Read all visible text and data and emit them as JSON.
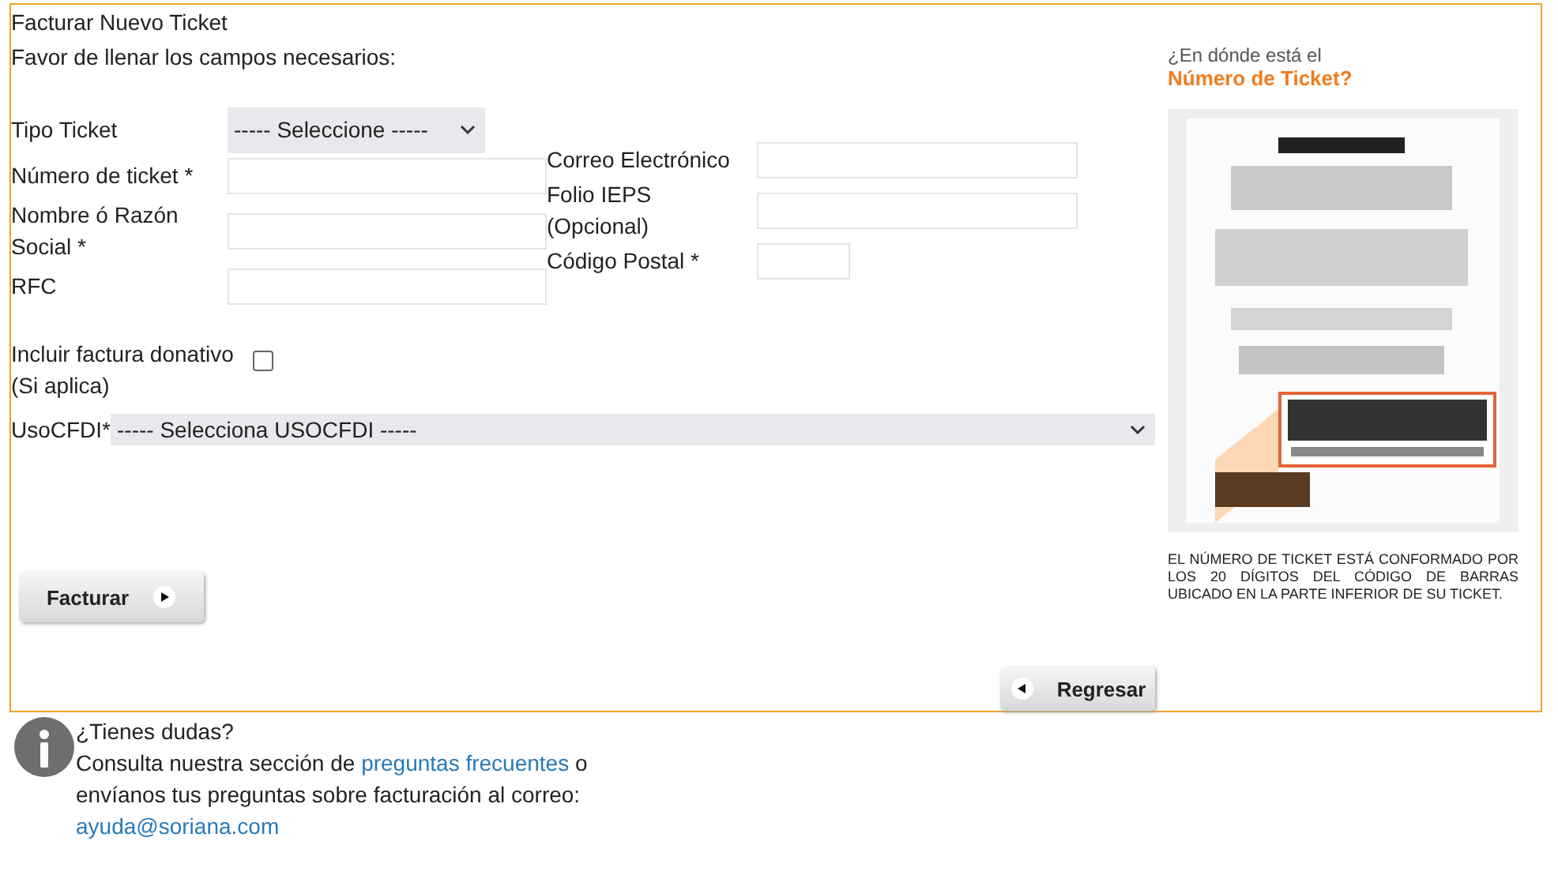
{
  "title": "Facturar Nuevo Ticket",
  "subtitle": "Favor de llenar los campos necesarios:",
  "ticket_type": {
    "label": "Tipo Ticket",
    "value": "----- Seleccione -----"
  },
  "left_fields": [
    {
      "label": "Número de ticket *"
    },
    {
      "label": "Nombre ó Razón Social *"
    },
    {
      "label": "RFC"
    }
  ],
  "right_fields": [
    {
      "label": "Correo Electrónico",
      "kind": "wide"
    },
    {
      "label": "Folio IEPS (Opcional)",
      "kind": "wide"
    },
    {
      "label": "Código Postal *",
      "kind": "short"
    }
  ],
  "donation": {
    "label": "Incluir factura donativo (Si aplica)",
    "checked": false
  },
  "uso_cfdi": {
    "label": "UsoCFDI*",
    "value": "----- Selecciona USOCFDI -----"
  },
  "submit_button": "Facturar",
  "back_button": "Regresar",
  "help_panel": {
    "heading": "¿En dónde está el",
    "heading_accent": "Número de Ticket?",
    "caption": "EL NÚMERO DE TICKET ESTÁ CONFORMADO POR LOS 20 DÍGITOS DEL CÓDIGO DE BARRAS UBICADO EN LA PARTE INFERIOR DE SU TICKET."
  },
  "footer": {
    "question": "¿Tienes dudas?",
    "text_before": "Consulta nuestra sección de",
    "link": "preguntas frecuentes",
    "text_after": "o envíanos tus preguntas sobre facturación al correo:",
    "email": "ayuda@soriana.com"
  }
}
